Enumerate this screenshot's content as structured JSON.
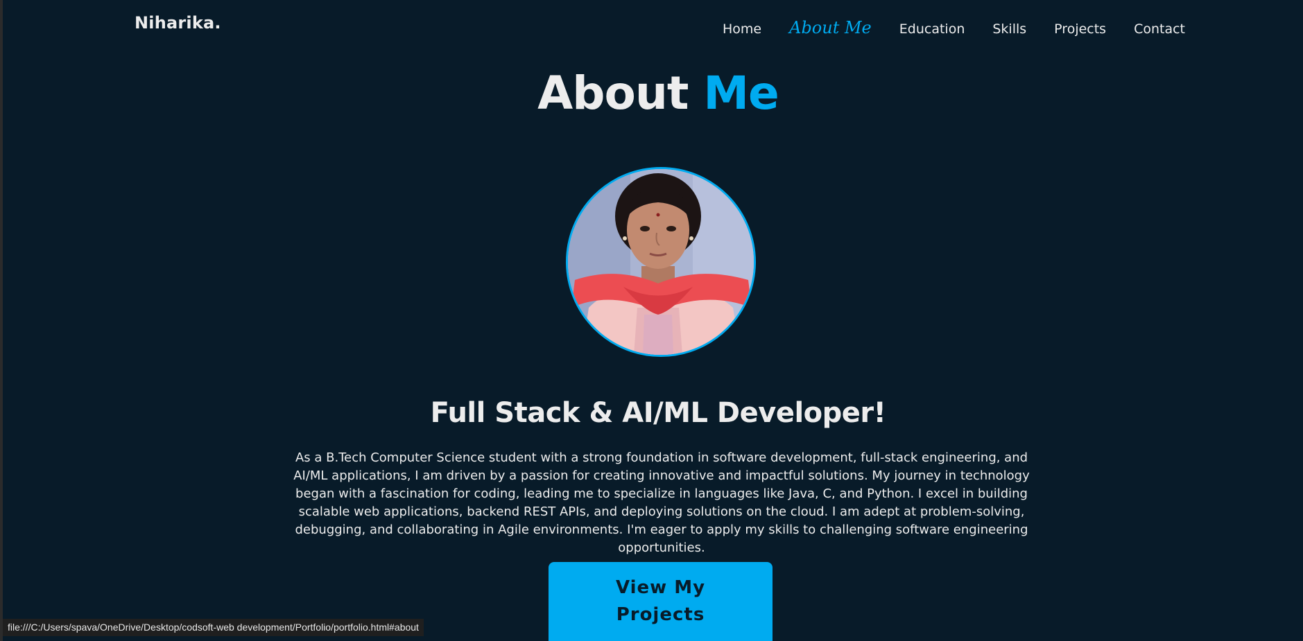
{
  "header": {
    "logo": "Niharika.",
    "nav": [
      {
        "label": "Home"
      },
      {
        "label": "About Me",
        "active": true
      },
      {
        "label": "Education"
      },
      {
        "label": "Skills"
      },
      {
        "label": "Projects"
      },
      {
        "label": "Contact"
      }
    ]
  },
  "about": {
    "heading_main": "About",
    "heading_accent": "Me",
    "subheading": "Full Stack & AI/ML Developer!",
    "bio": "As a B.Tech Computer Science student with a strong foundation in software development, full-stack engineering, and AI/ML applications, I am driven by a passion for creating innovative and impactful solutions. My journey in technology began with a fascination for coding, leading me to specialize in languages like Java, C, and Python. I excel in building scalable web applications, backend REST APIs, and deploying solutions on the cloud. I am adept at problem-solving, debugging, and collaborating in Agile environments. I'm eager to apply my skills to challenging software engineering opportunities.",
    "cta_label": "View My Projects"
  },
  "status_bar": {
    "url": "file:///C:/Users/spava/OneDrive/Desktop/codsoft-web development/Portfolio/portfolio.html#about"
  },
  "colors": {
    "background": "#081b29",
    "accent": "#00abf0",
    "text": "#ededed"
  },
  "icons": {
    "profile_photo": "profile-photo"
  }
}
